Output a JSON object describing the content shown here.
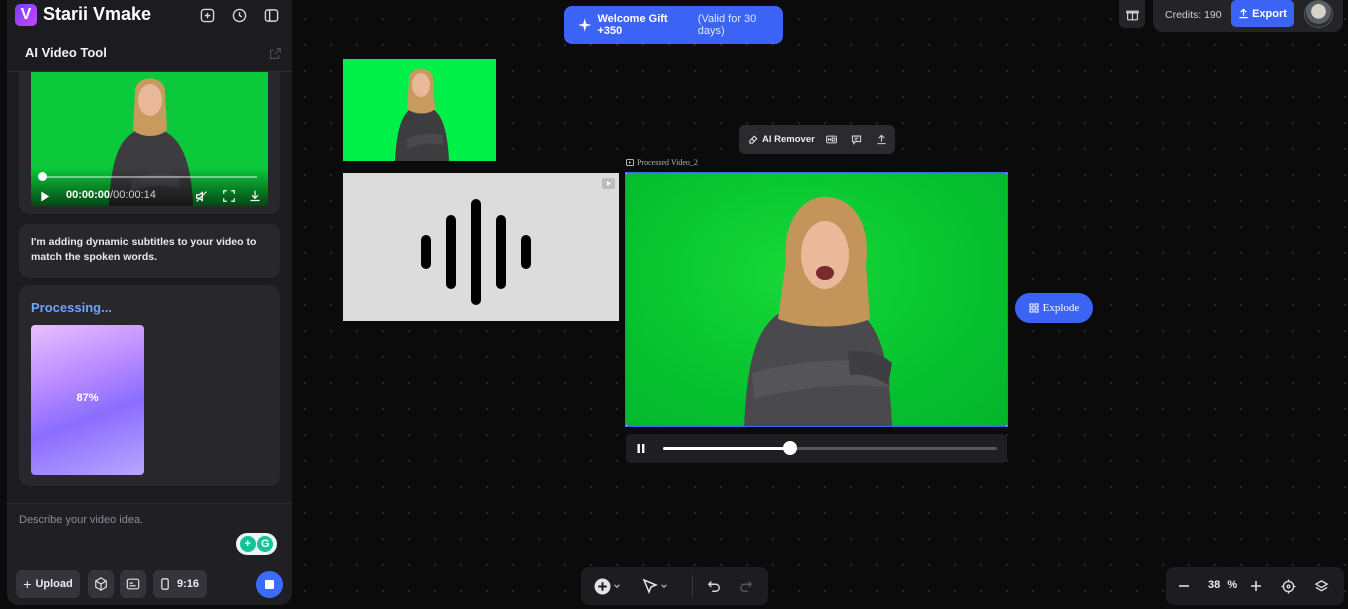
{
  "app": {
    "brand": "Starii Vmake",
    "logo_letter": "V"
  },
  "sidebar": {
    "title": "AI Video Tool",
    "video": {
      "current_time": "00:00:00",
      "duration": "/00:00:14",
      "progress": 0.0
    },
    "message": "I'm adding dynamic subtitles to your video to match the spoken words.",
    "processing": {
      "title": "Processing...",
      "percent": "87%"
    },
    "prompt": {
      "placeholder": "Describe your video idea.",
      "upload_label": "Upload",
      "aspect_label": "9:16"
    }
  },
  "top": {
    "welcome": {
      "label": "Welcome Gift +350",
      "note": "(Valid for 30 days)"
    },
    "credits_label": "Credits: 190",
    "export_label": "Export"
  },
  "canvas": {
    "toolbar": {
      "ai_remover_label": "AI Remover"
    },
    "video_label": "Processed Video_2",
    "playback_progress": 0.38,
    "explode_label": "Explode"
  },
  "zoom": {
    "value": "38",
    "unit": "%"
  },
  "colors": {
    "accent": "#3b63f5",
    "green_screen": "#05c22f",
    "processing_text": "#6ea4ff"
  }
}
